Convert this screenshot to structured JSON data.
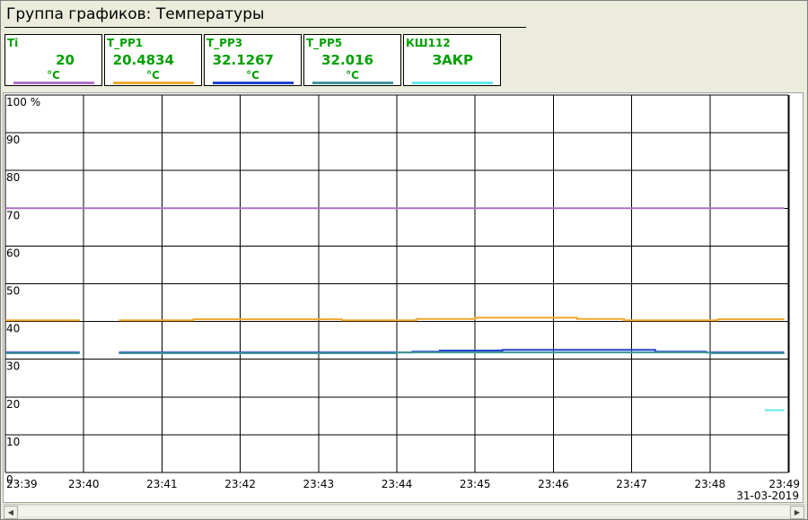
{
  "window": {
    "title": "Группа графиков: Температуры"
  },
  "tiles": [
    {
      "name": "Ti",
      "value": "20",
      "unit": "°C",
      "color": "#b070c8"
    },
    {
      "name": "T_PP1",
      "value": "20.4834",
      "unit": "°C",
      "color": "#f0a830"
    },
    {
      "name": "T_PP3",
      "value": "32.1267",
      "unit": "°C",
      "color": "#2040d0"
    },
    {
      "name": "T_PP5",
      "value": "32.016",
      "unit": "°C",
      "color": "#409898"
    },
    {
      "name": "КШ112",
      "value": "ЗАКР",
      "unit": "",
      "color": "#60e8f0"
    }
  ],
  "chart_data": {
    "type": "line",
    "y_unit": "%",
    "ylim": [
      0,
      100
    ],
    "y_ticks": [
      "100",
      "90",
      "80",
      "70",
      "60",
      "50",
      "40",
      "30",
      "20",
      "10",
      "0"
    ],
    "x_ticks": [
      "23:39",
      "23:40",
      "23:41",
      "23:42",
      "23:43",
      "23:44",
      "23:45",
      "23:46",
      "23:47",
      "23:48",
      "23:49"
    ],
    "xlim": [
      0,
      10
    ],
    "date": "31-03-2019",
    "grid": true,
    "series": [
      {
        "name": "Ti",
        "color": "#b070c8",
        "segments": [
          [
            [
              0,
              70
            ],
            [
              0.95,
              70
            ]
          ],
          [
            [
              0.95,
              70
            ],
            [
              1.45,
              70
            ]
          ],
          [
            [
              1.45,
              70
            ],
            [
              9.95,
              70
            ]
          ]
        ]
      },
      {
        "name": "T_PP1",
        "color": "#f0a830",
        "segments": [
          [
            [
              0,
              40.3
            ],
            [
              0.95,
              40.3
            ]
          ],
          [
            [
              1.45,
              40.3
            ],
            [
              2.4,
              40.3
            ],
            [
              2.4,
              40.6
            ],
            [
              4.3,
              40.6
            ],
            [
              4.3,
              40.3
            ],
            [
              5.25,
              40.3
            ],
            [
              5.25,
              40.7
            ],
            [
              6.0,
              40.7
            ],
            [
              6.0,
              41.0
            ],
            [
              7.3,
              41.0
            ],
            [
              7.3,
              40.7
            ],
            [
              7.9,
              40.7
            ],
            [
              7.9,
              40.3
            ],
            [
              9.1,
              40.3
            ],
            [
              9.1,
              40.6
            ],
            [
              9.95,
              40.6
            ]
          ]
        ]
      },
      {
        "name": "T_PP3",
        "color": "#2040d0",
        "segments": [
          [
            [
              0,
              31.8
            ],
            [
              0.95,
              31.8
            ]
          ],
          [
            [
              1.45,
              31.8
            ],
            [
              5.2,
              31.8
            ],
            [
              5.2,
              32.0
            ],
            [
              5.55,
              32.0
            ],
            [
              5.55,
              32.3
            ],
            [
              6.35,
              32.3
            ],
            [
              6.35,
              32.5
            ],
            [
              8.3,
              32.5
            ],
            [
              8.3,
              32.0
            ],
            [
              8.95,
              32.0
            ],
            [
              8.95,
              31.8
            ],
            [
              9.95,
              31.8
            ]
          ]
        ]
      },
      {
        "name": "T_PP5",
        "color": "#409898",
        "segments": [
          [
            [
              0,
              31.6
            ],
            [
              0.95,
              31.6
            ]
          ],
          [
            [
              1.45,
              31.6
            ],
            [
              5.0,
              31.6
            ],
            [
              5.0,
              31.8
            ],
            [
              9.0,
              31.8
            ],
            [
              9.0,
              31.6
            ],
            [
              9.95,
              31.6
            ]
          ]
        ]
      },
      {
        "name": "КШ112",
        "color": "#60e8f0",
        "segments": [
          [
            [
              9.7,
              16.5
            ],
            [
              9.95,
              16.5
            ]
          ]
        ]
      }
    ]
  }
}
